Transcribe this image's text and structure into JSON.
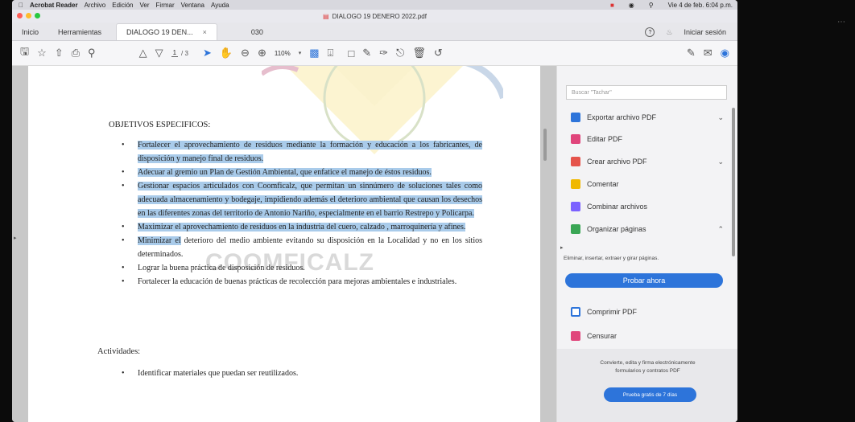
{
  "menubar": {
    "app": "Acrobat Reader",
    "items": [
      "Archivo",
      "Edición",
      "Ver",
      "Firmar",
      "Ventana",
      "Ayuda"
    ],
    "clock": "Vie 4 de feb. 6:04 p.m."
  },
  "window": {
    "title": "DIALOGO 19 DENERO 2022.pdf"
  },
  "tabs": {
    "home": "Inicio",
    "tools": "Herramientas",
    "doc1": "DIALOGO 19 DEN...",
    "doc1_close": "×",
    "doc2": "030",
    "sign_in": "Iniciar sesión"
  },
  "toolbar": {
    "page_current": "1",
    "page_total": "/ 3",
    "zoom": "110%"
  },
  "document": {
    "heading": "OBJETIVOS ESPECIFICOS:",
    "watermark": "COOMFICALZ",
    "bullets": [
      {
        "text": "Fortalecer el aprovechamiento de residuos mediante la formación y educación a los fabricantes, de disposición y manejo final de residuos.",
        "highlighted": true
      },
      {
        "text": "Adecuar al gremio un Plan de Gestión Ambiental, que enfatice el manejo de éstos residuos.",
        "highlighted": true
      },
      {
        "text": "Gestionar espacios articulados con Coomficalz, que permitan un sinnúmero de soluciones tales como adecuada almacenamiento y bodegaje, impidiendo además el deterioro ambiental que causan los desechos en las diferentes zonas del territorio de Antonio Nariño, especialmente en el barrio Restrepo y Policarpa.",
        "highlighted": true
      },
      {
        "text": "Maximizar el aprovechamiento de residuos en la industria del cuero, calzado , marroquinería y afines.",
        "highlighted": true
      },
      {
        "highlight_part": "Minimizar el",
        "rest": " deterioro del medio ambiente evitando su disposición en la Localidad y no en los sitios determinados."
      },
      {
        "text": "Lograr la buena práctica de disposición de residuos.",
        "highlighted": false
      },
      {
        "text": "Fortalecer la educación de buenas prácticas de recolección para mejoras ambientales e industriales.",
        "highlighted": false
      }
    ],
    "activities_heading": "Actividades:",
    "activities": [
      "Identificar materiales que puedan ser reutilizados."
    ]
  },
  "panel": {
    "search_placeholder": "Buscar \"Tachar\"",
    "items": [
      {
        "label": "Exportar archivo PDF",
        "icon": "export-pdf-icon",
        "color": "#2d74da"
      },
      {
        "label": "Editar PDF",
        "icon": "edit-pdf-icon",
        "color": "#e0457b"
      },
      {
        "label": "Crear archivo PDF",
        "icon": "create-pdf-icon",
        "color": "#e5534b"
      },
      {
        "label": "Comentar",
        "icon": "comment-icon",
        "color": "#f0b800"
      },
      {
        "label": "Combinar archivos",
        "icon": "combine-icon",
        "color": "#7b61ff"
      },
      {
        "label": "Organizar páginas",
        "icon": "organize-icon",
        "color": "#3aa655"
      }
    ],
    "organize_sub": "Eliminar, insertar, extraer y girar páginas.",
    "try_now": "Probar ahora",
    "compress": "Comprimir PDF",
    "compress_color": "#2d74da",
    "redact": "Censurar",
    "redact_color": "#e0457b",
    "promo_text_1": "Convierte, edita y firma electrónicamente",
    "promo_text_2": "formularios y contratos PDF",
    "promo_button": "Prueba gratis de 7 días"
  },
  "colors": {
    "accent": "#2d74da",
    "highlight": "#a9cbea"
  }
}
